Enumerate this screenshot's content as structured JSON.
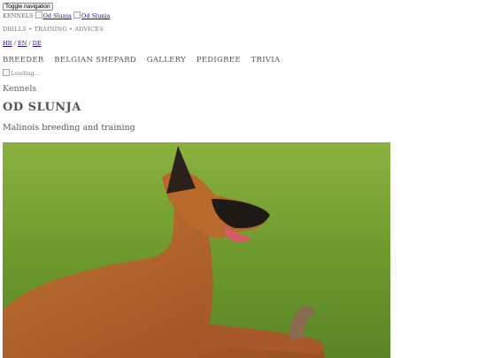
{
  "header": {
    "toggle_label": "Toggle navigation",
    "brand_prefix": "KENNELS",
    "logo_alt_1": "Od Slunja",
    "logo_alt_2": "Od Slunja",
    "tagline": "DRILLS • TRAINING • ADVICES"
  },
  "languages": {
    "hr": "HR",
    "sep1": " / ",
    "en": "EN",
    "sep2": " / ",
    "de": "DE"
  },
  "nav": [
    "BREEDER",
    "BELGIAN SHEPARD",
    "GALLERY",
    "PEDIGREE",
    "TRIVIA"
  ],
  "loading_alt": "Loading...",
  "main": {
    "kicker": "Kennels",
    "title": "OD SLUNJA",
    "subtitle": "Malinois breeding and training"
  },
  "colors": {
    "grass": "#6f9a2e",
    "dog": "#b5652c",
    "muzzle": "#1f1a16"
  }
}
